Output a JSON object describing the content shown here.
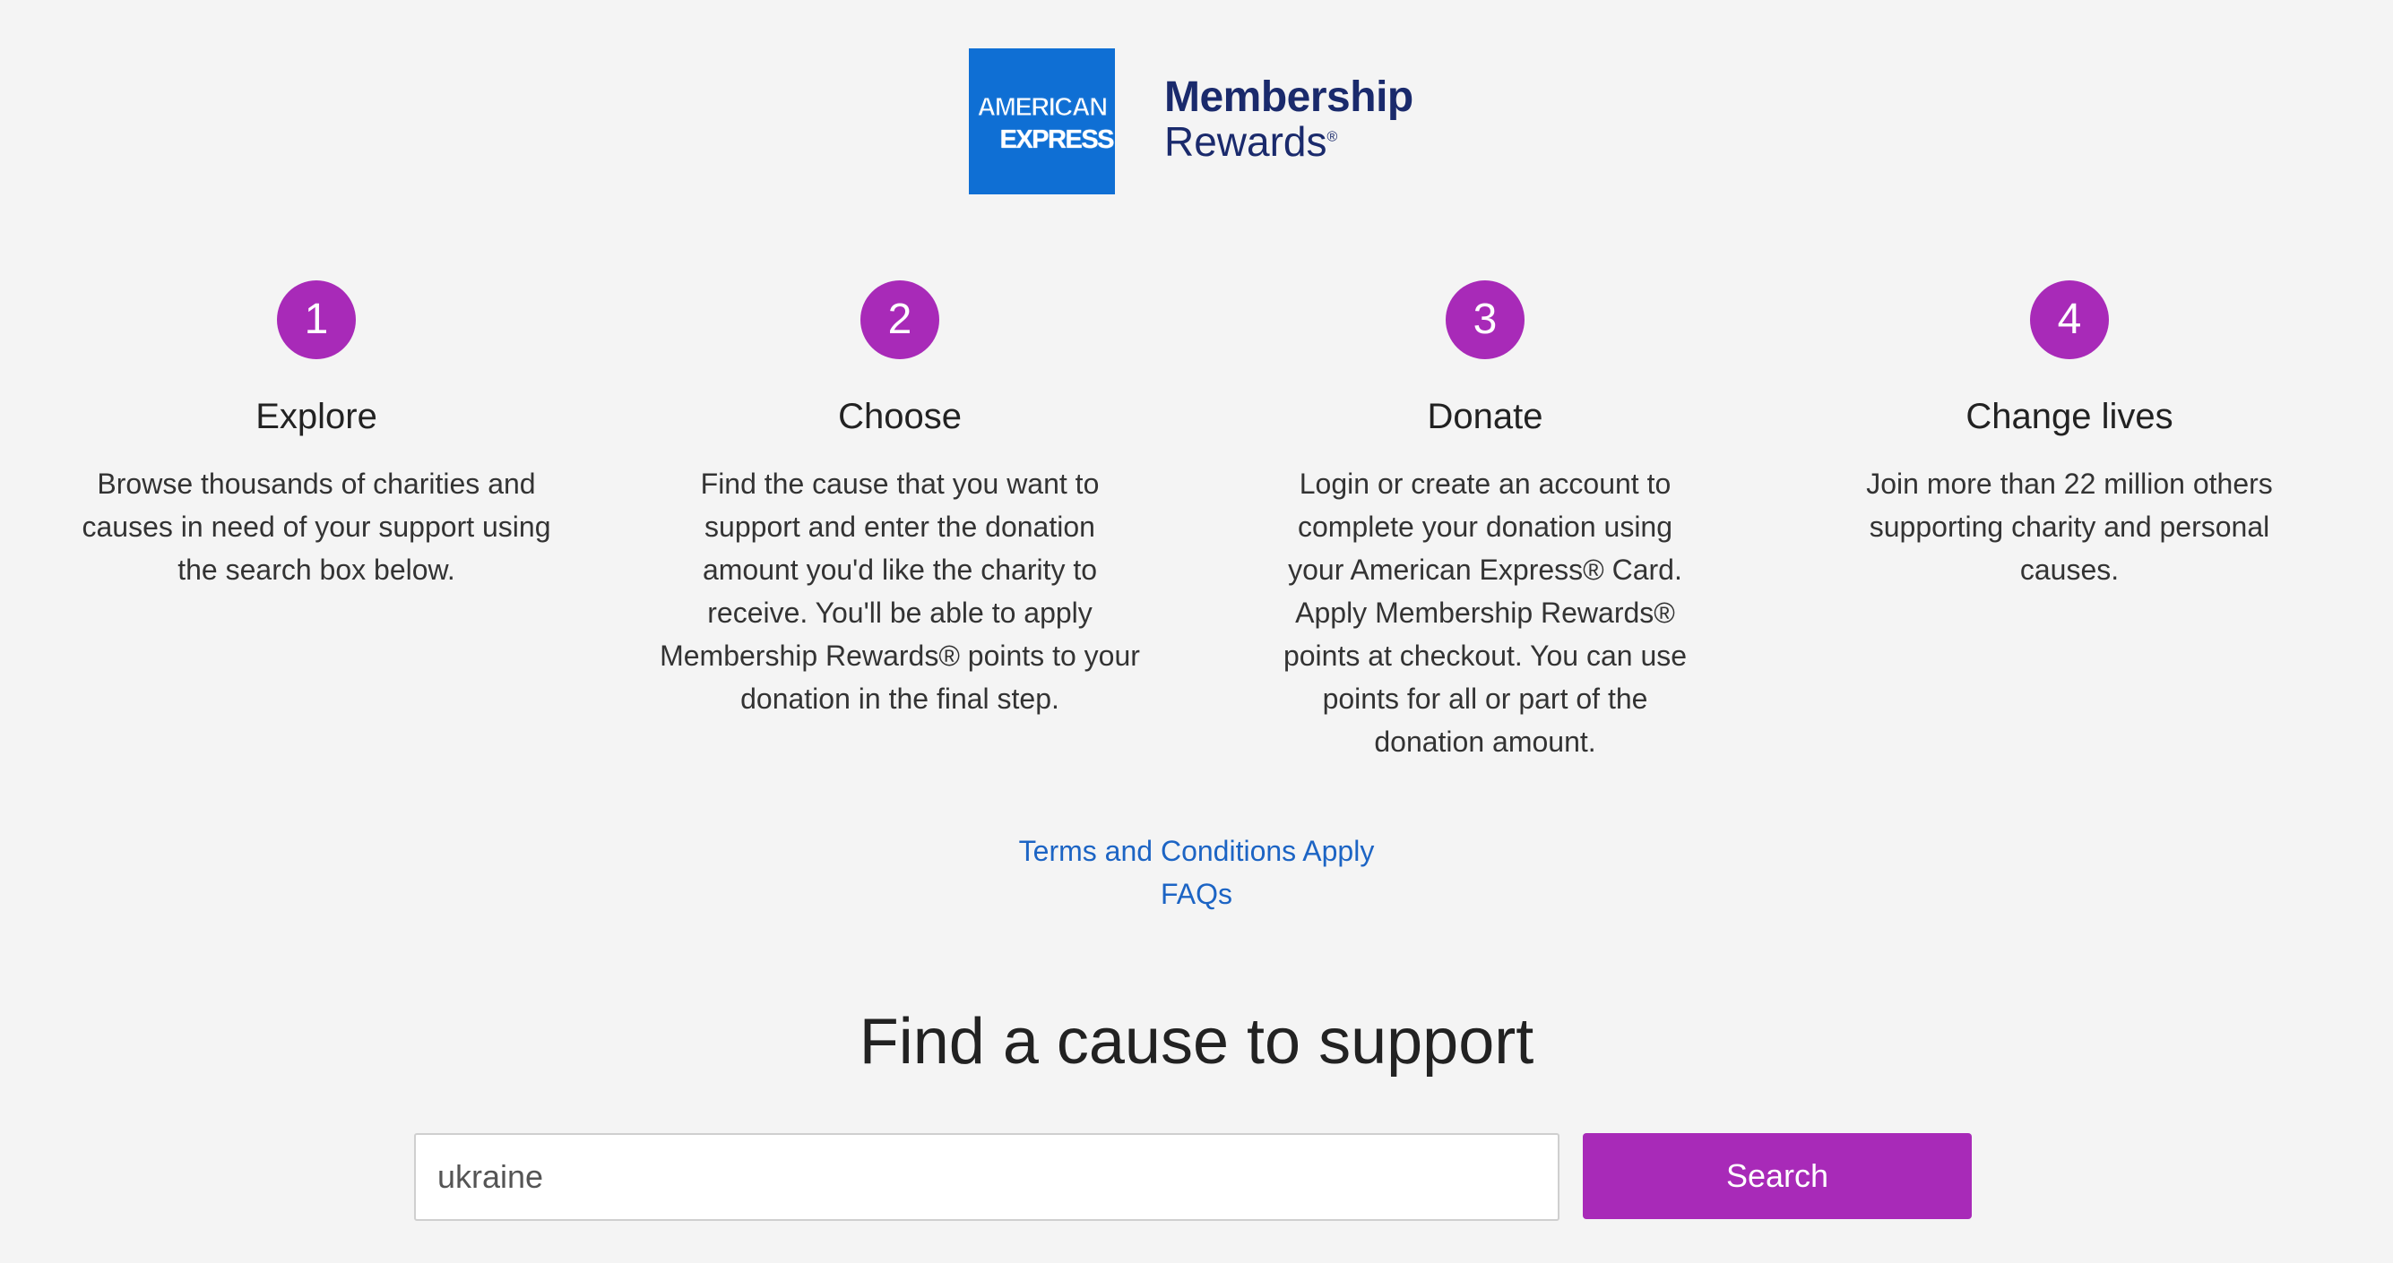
{
  "header": {
    "amex_logo_line1": "AMERICAN",
    "amex_logo_line2": "EXPRESS",
    "membership": "Membership",
    "rewards": "Rewards",
    "reg_mark": "®",
    "brand_color": "#0f6fd4",
    "text_color": "#1a2a6c"
  },
  "steps": [
    {
      "number": "1",
      "title": "Explore",
      "description": "Browse thousands of charities and causes in need of your support using the search box below."
    },
    {
      "number": "2",
      "title": "Choose",
      "description": "Find the cause that you want to support and enter the donation amount you'd like the charity to receive. You'll be able to apply Membership Rewards® points to your donation in the final step."
    },
    {
      "number": "3",
      "title": "Donate",
      "description": "Login or create an account to complete your donation using your American Express® Card. Apply Membership Rewards® points at checkout. You can use points for all or part of the donation amount."
    },
    {
      "number": "4",
      "title": "Change lives",
      "description": "Join more than 22 million others supporting charity and personal causes."
    }
  ],
  "links": {
    "terms": "Terms and Conditions Apply",
    "faqs": "FAQs"
  },
  "search": {
    "heading": "Find a cause to support",
    "value": "ukraine",
    "button_label": "Search",
    "accent_color": "#a82ab8"
  }
}
